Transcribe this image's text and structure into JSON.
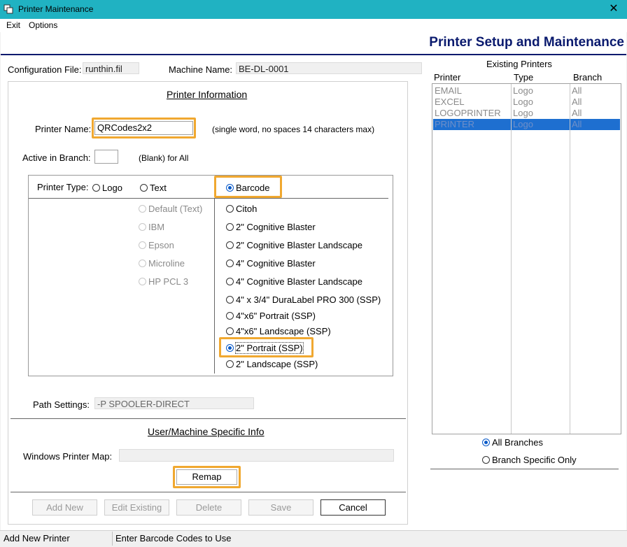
{
  "window": {
    "title": "Printer Maintenance",
    "close_glyph": "✕"
  },
  "menu": {
    "items": [
      "Exit",
      "Options"
    ]
  },
  "header": {
    "title": "Printer Setup and Maintenance"
  },
  "config": {
    "file_label": "Configuration File:",
    "file_value": "runthin.fil",
    "machine_label": "Machine Name:",
    "machine_value": "BE-DL-0001"
  },
  "printer_info": {
    "section_title": "Printer Information",
    "name_label": "Printer Name:",
    "name_value": "QRCodes2x2",
    "name_hint": "(single word, no spaces 14 characters max)",
    "branch_label": "Active in Branch:",
    "branch_value": "",
    "branch_hint": "(Blank) for All",
    "type_label": "Printer Type:",
    "type_options": [
      {
        "label": "Logo",
        "selected": false
      },
      {
        "label": "Text",
        "selected": false
      },
      {
        "label": "Barcode",
        "selected": true
      }
    ],
    "text_options": [
      "Default (Text)",
      "IBM",
      "Epson",
      "Microline",
      "HP PCL 3"
    ],
    "barcode_options": [
      {
        "label": "Citoh",
        "selected": false
      },
      {
        "label": "2\" Cognitive Blaster",
        "selected": false
      },
      {
        "label": "2\" Cognitive Blaster Landscape",
        "selected": false
      },
      {
        "label": "4\" Cognitive Blaster",
        "selected": false
      },
      {
        "label": "4\" Cognitive Blaster Landscape",
        "selected": false
      },
      {
        "label": "4\" x 3/4\" DuraLabel PRO 300 (SSP)",
        "selected": false
      },
      {
        "label": "4\"x6\" Portrait (SSP)",
        "selected": false
      },
      {
        "label": "4\"x6\" Landscape (SSP)",
        "selected": false
      },
      {
        "label": "2\" Portrait (SSP)",
        "selected": true
      },
      {
        "label": "2\" Landscape (SSP)",
        "selected": false
      }
    ],
    "path_label": "Path Settings:",
    "path_value": "-P SPOOLER-DIRECT"
  },
  "user_info": {
    "section_title": "User/Machine Specific Info",
    "map_label": "Windows Printer Map:",
    "map_value": "",
    "remap_label": "Remap"
  },
  "buttons": {
    "add_new": "Add New",
    "edit_existing": "Edit Existing",
    "delete": "Delete",
    "save": "Save",
    "cancel": "Cancel"
  },
  "existing": {
    "title": "Existing Printers",
    "columns": [
      "Printer",
      "Type",
      "Branch"
    ],
    "rows": [
      {
        "printer": "EMAIL",
        "type": "Logo",
        "branch": "All"
      },
      {
        "printer": "EXCEL",
        "type": "Logo",
        "branch": "All"
      },
      {
        "printer": "LOGOPRINTER",
        "type": "Logo",
        "branch": "All"
      },
      {
        "printer": "PRINTER",
        "type": "Logo",
        "branch": "All"
      }
    ],
    "selected_row": 3,
    "filter_options": [
      {
        "label": "All Branches",
        "selected": true
      },
      {
        "label": "Branch Specific Only",
        "selected": false
      }
    ]
  },
  "status": {
    "left": "Add New Printer",
    "right": "Enter Barcode Codes to Use"
  },
  "colors": {
    "titlebar": "#20b2c2",
    "banner": "#0a1a6e",
    "highlight": "#f0a830",
    "selection": "#1e6fd0"
  }
}
